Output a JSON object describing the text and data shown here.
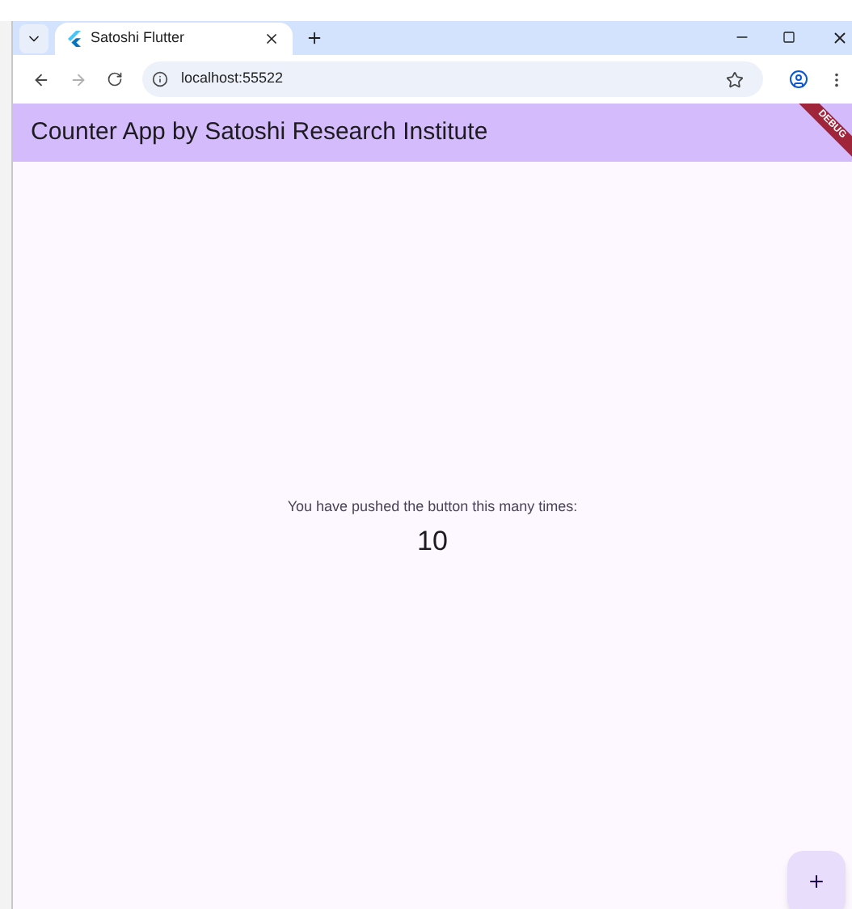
{
  "browser": {
    "tabs": [
      {
        "title": "Satoshi Flutter",
        "selected": true
      }
    ],
    "url": "localhost:55522"
  },
  "app_bar": {
    "title": "Counter App by Satoshi Research Institute"
  },
  "debug_banner": {
    "label": "DEBUG"
  },
  "body": {
    "message": "You have pushed the button this many times:",
    "counter": "10"
  }
}
